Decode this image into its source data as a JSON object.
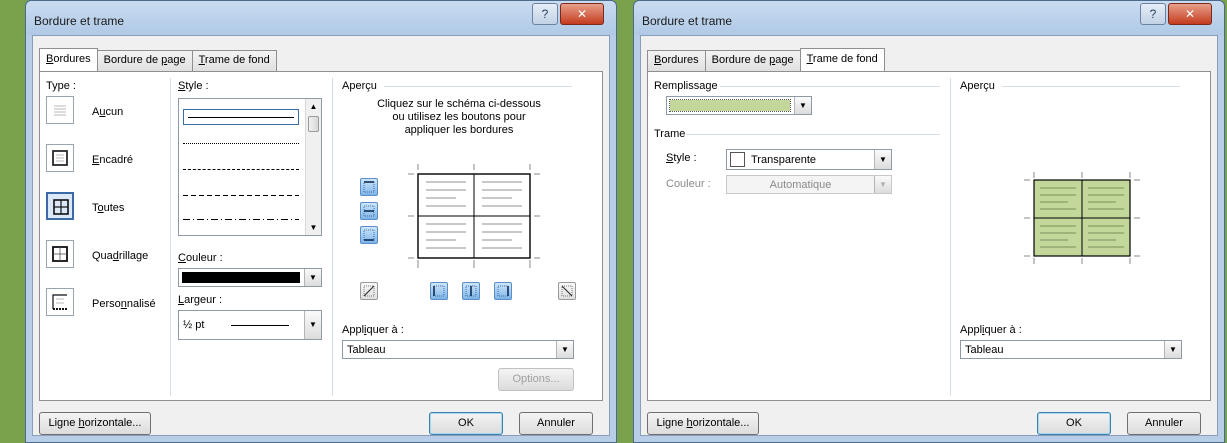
{
  "left": {
    "title": "Bordure et trame",
    "tabs": [
      {
        "label": "Bordures",
        "key": "B",
        "rest": "ordures"
      },
      {
        "label": "Bordure de page",
        "key": "p",
        "pre": "Bordure de ",
        "rest": "age"
      },
      {
        "label": "Trame de fond",
        "key": "T",
        "rest": "rame de fond"
      }
    ],
    "active_tab": "Bordures",
    "type_label": "Type :",
    "settings": [
      {
        "pre": "A",
        "key": "u",
        "rest": "cun",
        "label": "Aucun"
      },
      {
        "pre": "",
        "key": "E",
        "rest": "ncadré",
        "label": "Encadré"
      },
      {
        "pre": "T",
        "key": "o",
        "rest": "utes",
        "label": "Toutes"
      },
      {
        "pre": "Qua",
        "key": "d",
        "rest": "rillage",
        "label": "Quadrillage"
      },
      {
        "pre": "Perso",
        "key": "n",
        "rest": "nalisé",
        "label": "Personnalisé"
      }
    ],
    "selected_setting": "Toutes",
    "style_label": {
      "key": "S",
      "rest": "tyle :"
    },
    "color_label": {
      "key": "C",
      "rest": "ouleur :"
    },
    "color_value": "#000000",
    "width_label": {
      "key": "L",
      "rest": "argeur :"
    },
    "width_value": "½ pt",
    "preview_label": "Aperçu",
    "preview_hint": [
      "Cliquez sur le schéma ci-dessous",
      "ou utilisez les boutons pour",
      "appliquer les bordures"
    ],
    "apply_label": {
      "pre": "Appl",
      "key": "i",
      "rest": "quer à :"
    },
    "apply_value": "Tableau",
    "options_label": "Options...",
    "hline_label": {
      "pre": "Ligne ",
      "key": "h",
      "rest": "orizontale..."
    },
    "ok_label": "OK",
    "cancel_label": "Annuler"
  },
  "right": {
    "title": "Bordure et trame",
    "tabs": [
      {
        "label": "Bordures",
        "key": "B",
        "rest": "ordures"
      },
      {
        "label": "Bordure de page",
        "key": "p",
        "pre": "Bordure de ",
        "rest": "age"
      },
      {
        "label": "Trame de fond",
        "key": "T",
        "rest": "rame de fond"
      }
    ],
    "active_tab": "Trame de fond",
    "fill_label": "Remplissage",
    "fill_color": "#c4d79b",
    "pattern_label": "Trame",
    "style_label": {
      "key": "S",
      "rest": "tyle :"
    },
    "style_value": "Transparente",
    "color_label": "Couleur :",
    "color_value": "Automatique",
    "preview_label": "Aperçu",
    "apply_label": {
      "pre": "Appl",
      "key": "i",
      "rest": "quer à :"
    },
    "apply_value": "Tableau",
    "hline_label": {
      "pre": "Ligne ",
      "key": "h",
      "rest": "orizontale..."
    },
    "ok_label": "OK",
    "cancel_label": "Annuler"
  },
  "colors": {
    "fill": "#c4d79b",
    "accent": "#3a6aa8",
    "close": "#c43c20"
  }
}
